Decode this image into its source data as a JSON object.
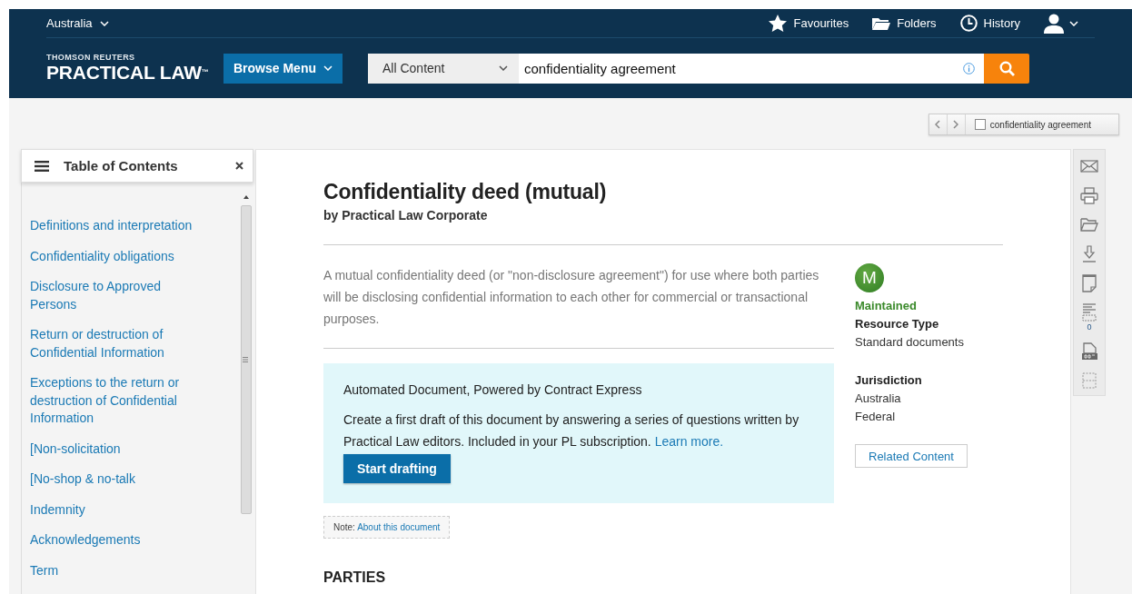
{
  "header": {
    "region": "Australia",
    "nav": [
      {
        "kind": "star",
        "label": "Favourites"
      },
      {
        "kind": "folder",
        "label": "Folders"
      },
      {
        "kind": "clock",
        "label": "History"
      }
    ],
    "brand": {
      "top": "THOMSON REUTERS",
      "name": "PRACTICAL LAW",
      "tm": "™"
    },
    "browse_button": "Browse Menu",
    "search": {
      "scope": "All Content",
      "value": "confidentiality agreement"
    }
  },
  "search_term_bar": {
    "term": "confidentiality agreement",
    "checked": false
  },
  "toc": {
    "title": "Table of Contents",
    "items": [
      "Definitions and interpretation",
      "Confidentiality obligations",
      "Disclosure to Approved Persons",
      "Return or destruction of Confidential Information",
      "Exceptions to the return or destruction of Confidential Information",
      "[Non-solicitation",
      "[No-shop & no-talk",
      "Indemnity",
      "Acknowledgements",
      "Term"
    ]
  },
  "document": {
    "title": "Confidentiality deed (mutual)",
    "author": "by Practical Law Corporate",
    "abstract": "A mutual confidentiality deed (or \"non-disclosure agreement\") for use where both parties will be disclosing confidential information to each other for commercial or transactional purposes.",
    "automation": {
      "heading": "Automated Document, Powered by Contract Express",
      "text": "Create a first draft of this document by answering a series of questions written by Practical Law editors. Included in your PL subscription.",
      "link": "Learn more.",
      "button": "Start drafting"
    },
    "note": {
      "label": "Note:",
      "link": "About this document"
    },
    "section_heading": "PARTIES"
  },
  "meta": {
    "badge": "M",
    "status": "Maintained",
    "fields": [
      {
        "label": "Resource Type",
        "values": [
          "Standard documents"
        ]
      },
      {
        "label": "Jurisdiction",
        "values": [
          "Australia",
          "Federal"
        ]
      }
    ],
    "related_button": "Related Content"
  },
  "tools": [
    {
      "kind": "email"
    },
    {
      "kind": "print"
    },
    {
      "kind": "folder"
    },
    {
      "kind": "download"
    },
    {
      "kind": "note"
    },
    {
      "kind": "annotations",
      "count": "0"
    },
    {
      "kind": "doc"
    },
    {
      "kind": "select"
    }
  ]
}
